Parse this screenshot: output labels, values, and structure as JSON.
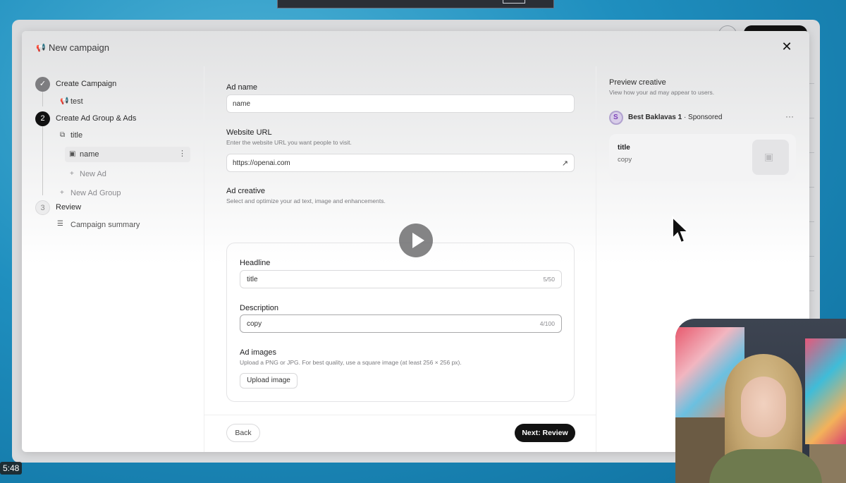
{
  "video": {
    "timestamp": "5:48"
  },
  "modal": {
    "title": "New campaign",
    "close_icon": "close-icon"
  },
  "stepper": {
    "steps": [
      {
        "number": "✓",
        "label": "Create Campaign",
        "state": "done"
      },
      {
        "number": "2",
        "label": "Create Ad Group & Ads",
        "state": "active"
      },
      {
        "number": "3",
        "label": "Review",
        "state": "pending"
      }
    ],
    "campaign_name": "test",
    "ad_group_name": "title",
    "ad_name": "name",
    "new_ad": "New Ad",
    "new_ad_group": "New Ad Group",
    "campaign_summary": "Campaign summary"
  },
  "form": {
    "ad_name_label": "Ad name",
    "ad_name_value": "name",
    "website_label": "Website URL",
    "website_sub": "Enter the website URL you want people to visit.",
    "website_value": "https://openai.com",
    "creative_label": "Ad creative",
    "creative_sub": "Select and optimize your ad text, image and enhancements.",
    "headline_label": "Headline",
    "headline_value": "title",
    "headline_count": "5/50",
    "description_label": "Description",
    "description_value": "copy",
    "description_count": "4/100",
    "images_label": "Ad images",
    "images_sub": "Upload a PNG or JPG. For best quality, use a square image (at least 256 × 256 px).",
    "upload_label": "Upload image",
    "back_label": "Back",
    "next_label": "Next: Review"
  },
  "preview": {
    "title": "Preview creative",
    "sub": "View how your ad may appear to users.",
    "brand": "Best Baklavas 1",
    "sponsored": " · Sponsored",
    "card_title": "title",
    "card_copy": "copy",
    "more": "···"
  },
  "colors": {
    "primary_button": "#121212",
    "desktop_bg": "#1f8fbf"
  }
}
